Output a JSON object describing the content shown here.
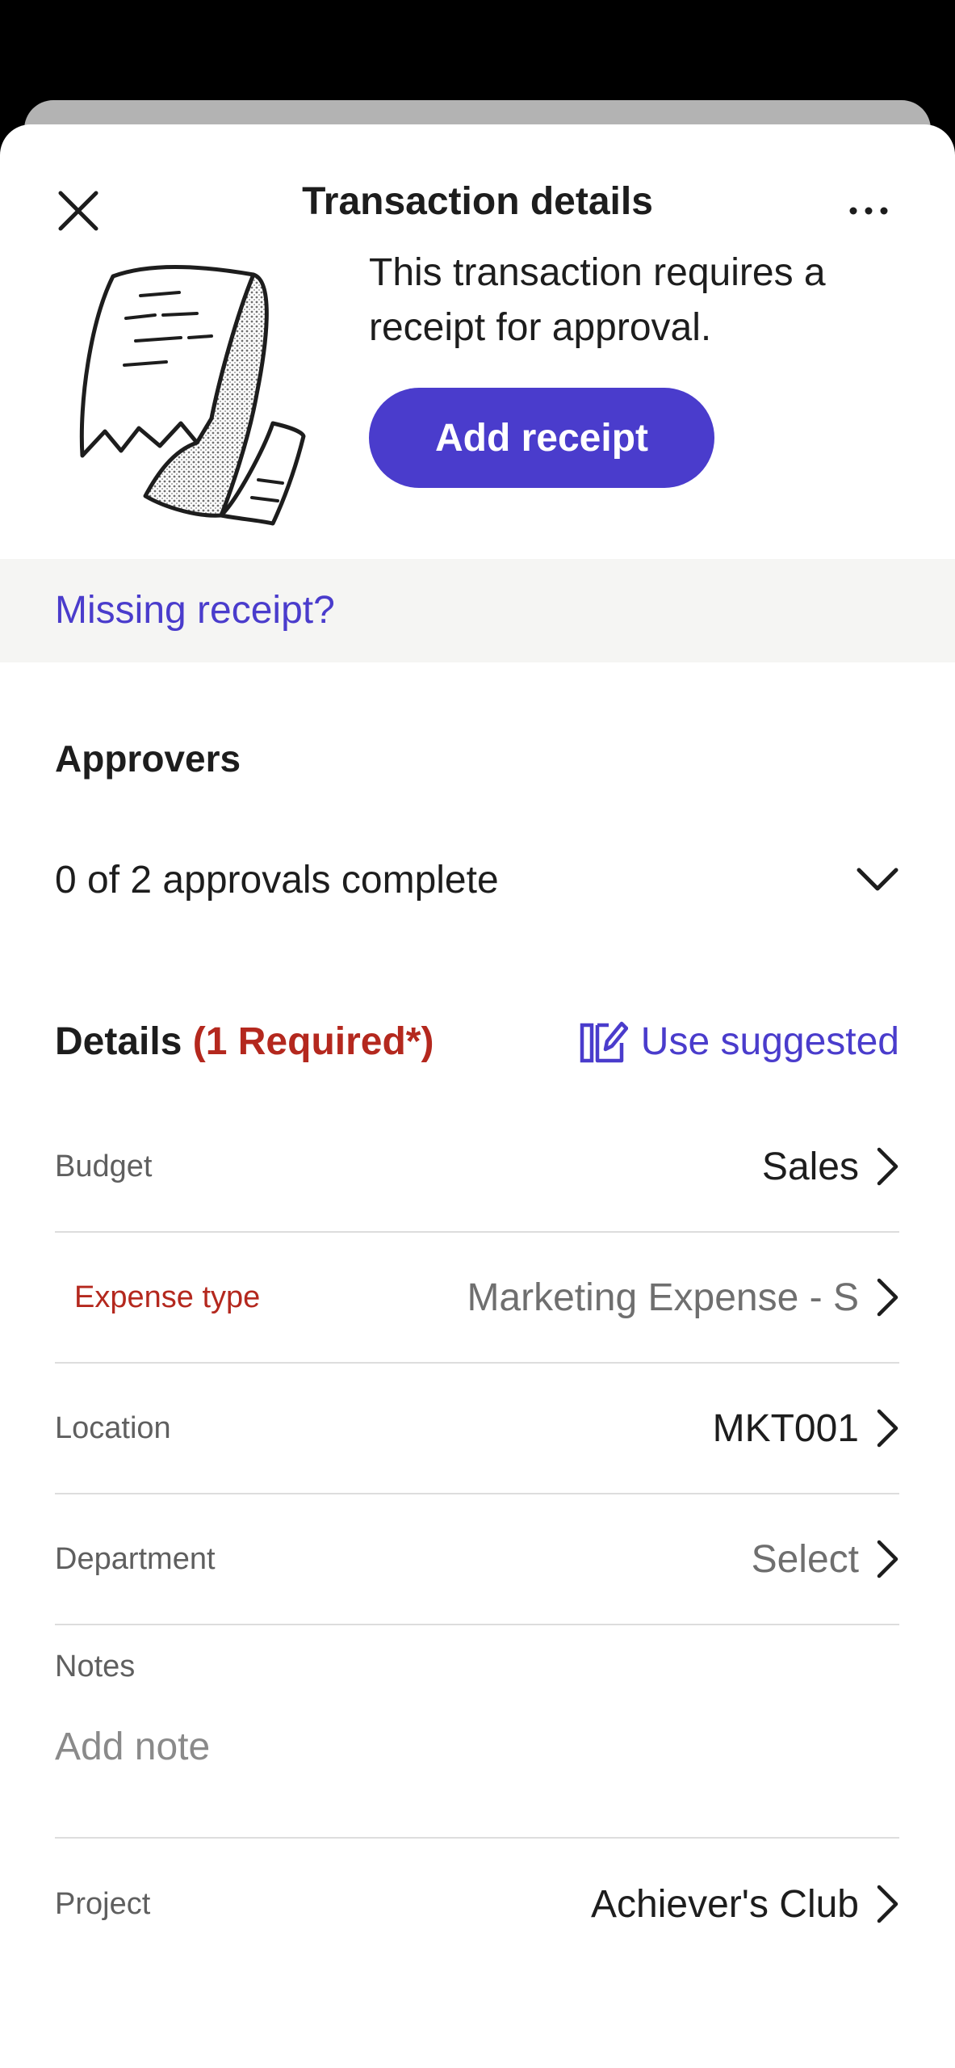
{
  "header": {
    "title": "Transaction details"
  },
  "receipt_prompt": {
    "message": "This transaction requires a receipt for approval.",
    "add_button_label": "Add receipt",
    "missing_link_label": "Missing receipt?"
  },
  "approvers": {
    "heading": "Approvers",
    "status": "0 of 2 approvals complete"
  },
  "details": {
    "heading": "Details",
    "required_note": "(1 Required*)",
    "use_suggested_label": "Use suggested",
    "fields": [
      {
        "label": "Budget",
        "value": "Sales"
      },
      {
        "label": "Expense type",
        "value": "Marketing Expense - S"
      },
      {
        "label": "Location",
        "value": "MKT001"
      },
      {
        "label": "Department",
        "value": "Select"
      }
    ],
    "notes": {
      "label": "Notes",
      "placeholder": "Add note"
    },
    "project": {
      "label": "Project",
      "value": "Achiever's Club"
    }
  },
  "colors": {
    "accent": "#4a3ccc",
    "required": "#b4281e",
    "missing_bar": "#f5f5f3"
  }
}
